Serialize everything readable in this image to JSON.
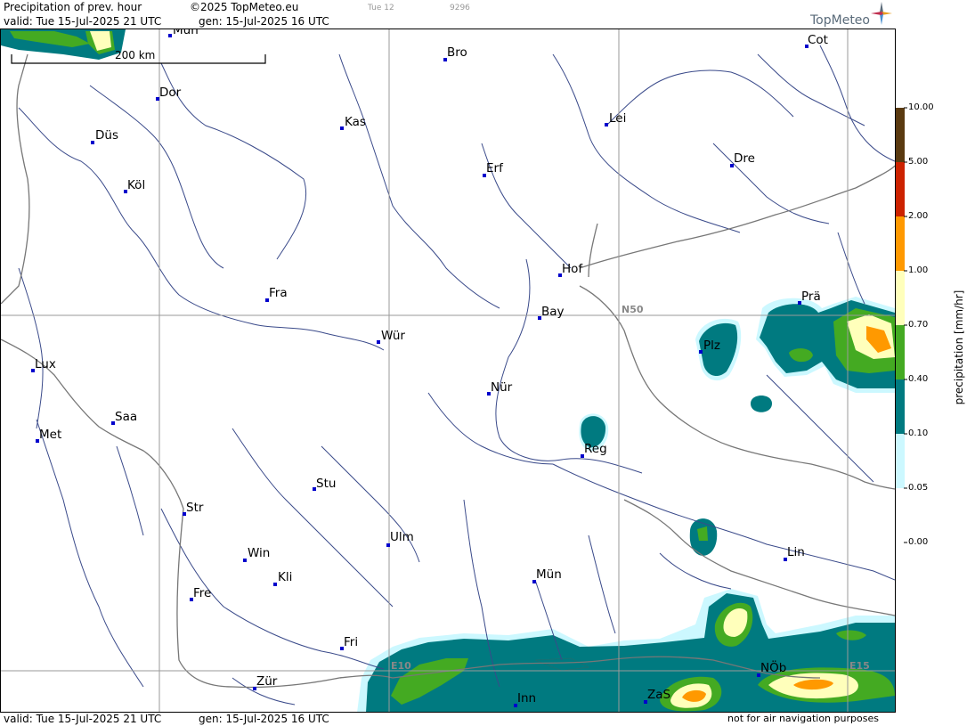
{
  "header": {
    "title": "Precipitation of prev. hour",
    "copyright": "©2025 TopMeteo.eu",
    "valid": "valid:  Tue  15-Jul-2025  21 UTC",
    "gen": "gen: 15-Jul-2025 16 UTC",
    "day_tag": "Tue 12",
    "code": "9296",
    "brand": "TopMeteo"
  },
  "footer": {
    "valid": "valid:  Tue  15-Jul-2025  21 UTC",
    "gen": "gen: 15-Jul-2025 16 UTC",
    "notice": "not for air navigation purposes"
  },
  "map": {
    "scale_label": "200 km",
    "grid_labels": {
      "lat50": "N50",
      "lon10": "E10",
      "lon15": "E15"
    },
    "cities": [
      "Mün",
      "Bro",
      "Cot",
      "Dor",
      "Kas",
      "Lei",
      "Düs",
      "Erf",
      "Dre",
      "Köl",
      "Hof",
      "Fra",
      "Bay",
      "Prä",
      "Wür",
      "Plz",
      "Lux",
      "Nür",
      "Saa",
      "Met",
      "Reg",
      "Stu",
      "Str",
      "Ulm",
      "Win",
      "Lin",
      "Kli",
      "Mün",
      "Fre",
      "Fri",
      "NÖb",
      "Zür",
      "ZaS",
      "Inn"
    ]
  },
  "legend": {
    "title": "precipitation [mm/hr]",
    "ticks": [
      "10.00",
      "5.00",
      "2.00",
      "1.00",
      "0.70",
      "0.40",
      "0.10",
      "0.05",
      "0.00"
    ],
    "colors": [
      "#5a3a10",
      "#cc2200",
      "#ff9900",
      "#ffffbb",
      "#44aa22",
      "#007a80",
      "#ccf8ff"
    ]
  }
}
